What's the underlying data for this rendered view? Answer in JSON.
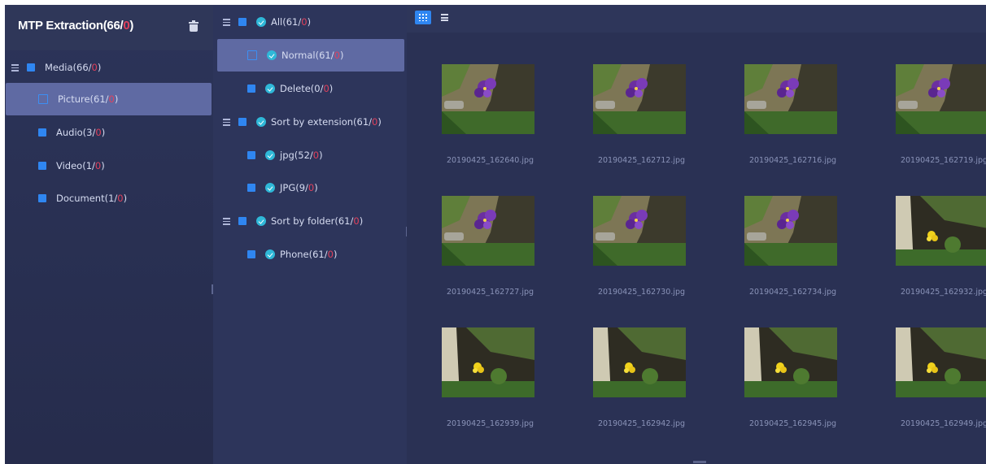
{
  "sidebar": {
    "title": "MTP Extraction(66/",
    "title_count": "0",
    "title_close": ")",
    "delete_icon": "trash-icon",
    "items": [
      {
        "label": "Media(66/",
        "count": "0",
        "close": ")"
      },
      {
        "label": "Picture(61/",
        "count": "0",
        "close": ")"
      },
      {
        "label": "Audio(3/",
        "count": "0",
        "close": ")"
      },
      {
        "label": "Video(1/",
        "count": "0",
        "close": ")"
      },
      {
        "label": "Document(1/",
        "count": "0",
        "close": ")"
      }
    ]
  },
  "filters": {
    "items": [
      {
        "label": "All(61/",
        "count": "0",
        "close": ")"
      },
      {
        "label": "Normal(61/",
        "count": "0",
        "close": ")"
      },
      {
        "label": "Delete(0/",
        "count": "0",
        "close": ")"
      },
      {
        "label": "Sort by extension(61/",
        "count": "0",
        "close": ")"
      },
      {
        "label": "jpg(52/",
        "count": "0",
        "close": ")"
      },
      {
        "label": "JPG(9/",
        "count": "0",
        "close": ")"
      },
      {
        "label": "Sort by folder(61/",
        "count": "0",
        "close": ")"
      },
      {
        "label": "Phone(61/",
        "count": "0",
        "close": ")"
      }
    ]
  },
  "toolbar": {
    "grid_view_icon": "grid-view-icon",
    "list_view_icon": "list-view-icon"
  },
  "gallery": {
    "files": [
      "20190425_162640.jpg",
      "20190425_162712.jpg",
      "20190425_162716.jpg",
      "20190425_162719.jpg",
      "20190425_162727.jpg",
      "20190425_162730.jpg",
      "20190425_162734.jpg",
      "20190425_162932.jpg",
      "20190425_162939.jpg",
      "20190425_162942.jpg",
      "20190425_162945.jpg",
      "20190425_162949.jpg"
    ]
  },
  "colors": {
    "accent": "#2f86f1",
    "selected_row": "#5f6aa3",
    "count_highlight": "#e0415c"
  }
}
